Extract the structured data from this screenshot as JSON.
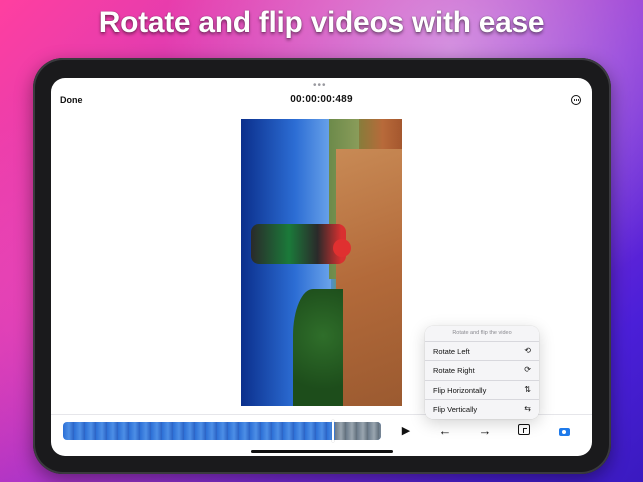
{
  "promo": {
    "headline": "Rotate and flip videos with ease"
  },
  "editor": {
    "done_label": "Done",
    "timecode": "00:00:00:489",
    "grabber": "•••",
    "more_icon": "ellipsis-circle-icon"
  },
  "toolbar": {
    "play_icon": "play-icon",
    "play_glyph": "▶",
    "left_glyph": "←",
    "right_glyph": "→",
    "layout_icon": "aspect-layout-icon",
    "camera_icon": "camera-icon",
    "accent_color": "#1f7aea"
  },
  "menu": {
    "title": "Rotate and flip the video",
    "items": [
      {
        "label": "Rotate Left",
        "icon": "rotate-left-icon",
        "glyph": "⟲"
      },
      {
        "label": "Rotate Right",
        "icon": "rotate-right-icon",
        "glyph": "⟳"
      },
      {
        "label": "Flip Horizontally",
        "icon": "flip-horizontal-icon",
        "glyph": "⇅"
      },
      {
        "label": "Flip Vertically",
        "icon": "flip-vertical-icon",
        "glyph": "⇆"
      }
    ]
  }
}
